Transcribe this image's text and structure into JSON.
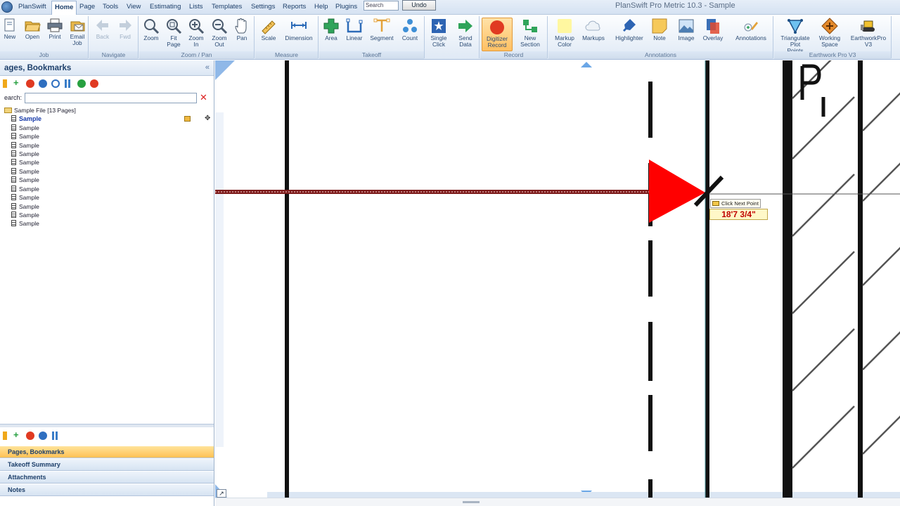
{
  "app": {
    "title": "PlanSwift Pro Metric 10.3 - Sample",
    "orb_label": "PlanSwift"
  },
  "menu": {
    "items": [
      "Home",
      "Page",
      "Tools",
      "View",
      "Estimating",
      "Lists",
      "Templates",
      "Settings",
      "Reports",
      "Help",
      "Plugins"
    ],
    "active": "Home",
    "search_placeholder": "Search",
    "undo_label": "Undo"
  },
  "ribbon": {
    "groups": [
      {
        "label": "Job",
        "buttons": [
          "New",
          "Open",
          "Print",
          "Email Job"
        ]
      },
      {
        "label": "Navigate",
        "buttons": [
          "Back",
          "Fwd"
        ]
      },
      {
        "label": "Zoom / Pan",
        "buttons": [
          "Zoom",
          "Fit Page",
          "Zoom In",
          "Zoom Out",
          "Pan"
        ]
      },
      {
        "label": "Measure",
        "buttons": [
          "Scale",
          "Dimension"
        ]
      },
      {
        "label": "Takeoff",
        "buttons": [
          "Area",
          "Linear",
          "Segment",
          "Count"
        ]
      },
      {
        "label": "",
        "buttons": [
          "Single Click",
          "Send Data"
        ]
      },
      {
        "label": "Record",
        "buttons": [
          "Digitizer Record",
          "New Section"
        ]
      },
      {
        "label": "Annotations",
        "buttons": [
          "Markup Color",
          "Markups",
          "Highlighter",
          "Note",
          "Image",
          "Overlay",
          "Annotations"
        ]
      },
      {
        "label": "Earthwork Pro V3",
        "buttons": [
          "Triangulate Plot Points",
          "Working Space",
          "EarthworkPro V3"
        ]
      }
    ]
  },
  "panel": {
    "title": "ages, Bookmarks",
    "search_label": "earch:",
    "root": "Sample File [13 Pages]",
    "pages": [
      "Sample",
      "Sample",
      "Sample",
      "Sample",
      "Sample",
      "Sample",
      "Sample",
      "Sample",
      "Sample",
      "Sample",
      "Sample",
      "Sample",
      "Sample"
    ],
    "selected_index": 0,
    "nav_tabs": [
      "Pages, Bookmarks",
      "Takeoff Summary",
      "Attachments",
      "Notes"
    ],
    "active_nav": "Pages, Bookmarks"
  },
  "canvas": {
    "tooltip_prompt": "Click Next Point",
    "measurement": "18'7 3/4\"",
    "drawing_glyph": "-P-",
    "pointer_color": "#ff0000"
  }
}
